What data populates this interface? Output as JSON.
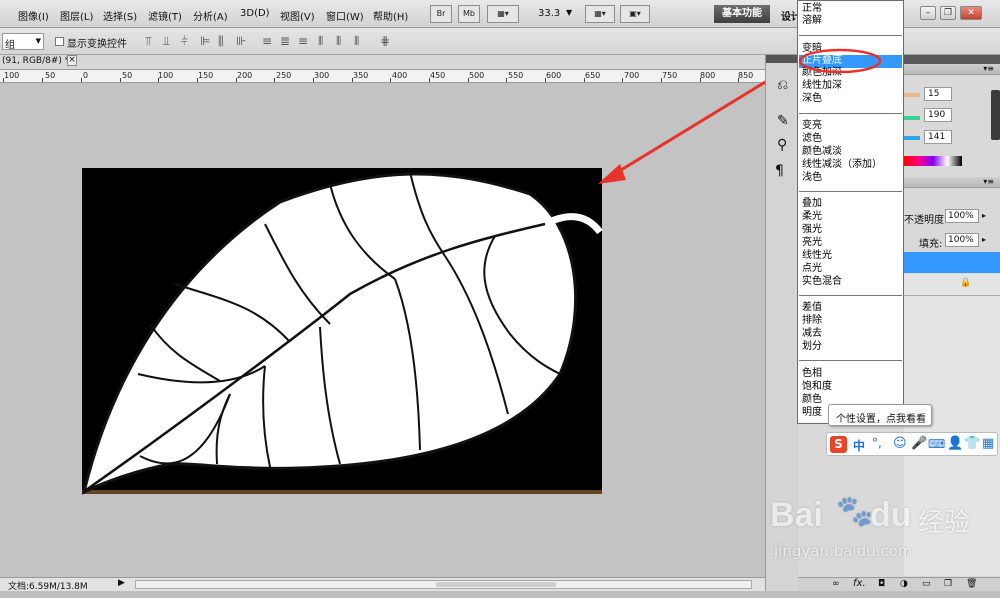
{
  "menubar": {
    "items": [
      "图像(I)",
      "图层(L)",
      "选择(S)",
      "滤镜(T)",
      "分析(A)",
      "3D(D)",
      "视图(V)",
      "窗口(W)",
      "帮助(H)"
    ],
    "btn_br": "Br",
    "btn_mb": "Mb",
    "zoom": "33.3",
    "workspace_active": "基本功能",
    "workspace_next": "设计"
  },
  "options": {
    "select_value": "组",
    "transform_label": "显示变换控件"
  },
  "document": {
    "tab_title": "(91, RGB/8#) *",
    "tab_close": "×",
    "ruler_labels": [
      "100",
      "50",
      "0",
      "50",
      "100",
      "150",
      "200",
      "250",
      "300",
      "350",
      "400",
      "450",
      "500",
      "550",
      "600",
      "650",
      "700",
      "750",
      "800",
      "850"
    ]
  },
  "status": {
    "doc_info": "文档:6.59M/13.8M"
  },
  "panels": {
    "values": [
      "15",
      "190",
      "141"
    ],
    "opacity_label": "不透明度:",
    "opacity_value": "100%",
    "fill_label": "填充:",
    "fill_value": "100%"
  },
  "blend_menu": {
    "groups": [
      [
        "正常",
        "溶解"
      ],
      [
        "变暗",
        "正片叠底",
        "颜色加深",
        "线性加深",
        "深色"
      ],
      [
        "变亮",
        "滤色",
        "颜色减淡",
        "线性减淡（添加）",
        "浅色"
      ],
      [
        "叠加",
        "柔光",
        "强光",
        "亮光",
        "线性光",
        "点光",
        "实色混合"
      ],
      [
        "差值",
        "排除",
        "减去",
        "划分"
      ],
      [
        "色相",
        "饱和度",
        "颜色",
        "明度"
      ]
    ],
    "highlighted": "正片叠底"
  },
  "ime": {
    "tooltip": "个性设置，点我看看",
    "zh": "中",
    "punct": "°,"
  },
  "watermark": {
    "brand": "Bai",
    "brand2": "du",
    "jingyan": "经验",
    "url": "jingyan.baidu.com"
  },
  "colors": {
    "accent_highlight": "#3399ff",
    "annotation_red": "#e8322a",
    "swatch_r": "#e6b98a",
    "swatch_g": "#3dcf8e",
    "swatch_b": "#2fa4e8"
  }
}
